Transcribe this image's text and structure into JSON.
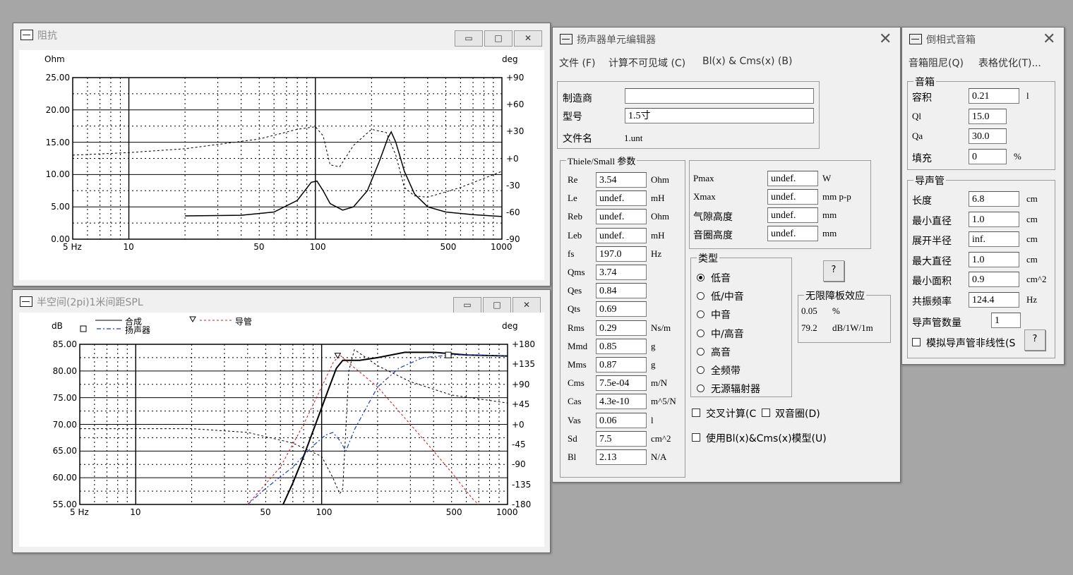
{
  "impedance": {
    "title": "阻抗",
    "y_unit": "Ohm",
    "phase_unit": "deg",
    "y_ticks": [
      "25.00",
      "20.00",
      "15.00",
      "10.00",
      "5.00",
      "0.00"
    ],
    "phase_ticks": [
      "+90",
      "+60",
      "+30",
      "+0",
      "-30",
      "-60",
      "-90"
    ],
    "x_ticks": [
      "5 Hz",
      "10",
      "50",
      "100",
      "500",
      "1000"
    ]
  },
  "spl": {
    "title": "半空间(2pi)1米间距SPL",
    "y_unit": "dB",
    "phase_unit": "deg",
    "legend": {
      "total": "合成",
      "driver": "扬声器",
      "port": "导管"
    },
    "y_ticks": [
      "85.00",
      "80.00",
      "75.00",
      "70.00",
      "65.00",
      "60.00",
      "55.00"
    ],
    "phase_ticks": [
      "+180",
      "+135",
      "+90",
      "+45",
      "+0",
      "-45",
      "-90",
      "-135",
      "-180"
    ],
    "x_ticks": [
      "5 Hz",
      "10",
      "50",
      "100",
      "500",
      "1000"
    ]
  },
  "window_buttons": {
    "min": "▭",
    "max": "□",
    "close": "✕"
  },
  "editor": {
    "title": "扬声器单元编辑器",
    "menu": [
      "文件 (F)",
      "计算不可见域 (C)",
      "Bl(x) & Cms(x) (B)"
    ],
    "maker_label": "制造商",
    "maker_value": "",
    "model_label": "型号",
    "model_value": "1.5寸",
    "file_label": "文件名",
    "file_value": "1.unt",
    "ts_group": "Thiele/Small 参数",
    "params": [
      {
        "name": "Re",
        "value": "3.54",
        "unit": "Ohm"
      },
      {
        "name": "Le",
        "value": "undef.",
        "unit": "mH"
      },
      {
        "name": "Reb",
        "value": "undef.",
        "unit": "Ohm"
      },
      {
        "name": "Leb",
        "value": "undef.",
        "unit": "mH"
      },
      {
        "name": "fs",
        "value": "197.0",
        "unit": "Hz"
      },
      {
        "name": "Qms",
        "value": "3.74",
        "unit": ""
      },
      {
        "name": "Qes",
        "value": "0.84",
        "unit": ""
      },
      {
        "name": "Qts",
        "value": "0.69",
        "unit": ""
      },
      {
        "name": "Rms",
        "value": "0.29",
        "unit": "Ns/m"
      },
      {
        "name": "Mmd",
        "value": "0.85",
        "unit": "g"
      },
      {
        "name": "Mms",
        "value": "0.87",
        "unit": "g"
      },
      {
        "name": "Cms",
        "value": "7.5e-04",
        "unit": "m/N"
      },
      {
        "name": "Cas",
        "value": "4.3e-10",
        "unit": "m^5/N"
      },
      {
        "name": "Vas",
        "value": "0.06",
        "unit": "l"
      },
      {
        "name": "Sd",
        "value": "7.5",
        "unit": "cm^2"
      },
      {
        "name": "Bl",
        "value": "2.13",
        "unit": "N/A"
      }
    ],
    "limits": [
      {
        "name": "Pmax",
        "value": "undef.",
        "unit": "W"
      },
      {
        "name": "Xmax",
        "value": "undef.",
        "unit": "mm p-p"
      },
      {
        "name": "气隙高度",
        "value": "undef.",
        "unit": "mm"
      },
      {
        "name": "音圈高度",
        "value": "undef.",
        "unit": "mm"
      }
    ],
    "type_group": "类型",
    "types": [
      "低音",
      "低/中音",
      "中音",
      "中/高音",
      "高音",
      "全频带",
      "无源辐射器"
    ],
    "type_selected": 0,
    "help": "?",
    "baffle_group": "无限障板效应",
    "baffle_eff": "0.05",
    "baffle_eff_unit": "%",
    "baffle_spl": "79.2",
    "baffle_spl_unit": "dB/1W/1m",
    "cross_calc": "交叉计算(C",
    "dual_coil": "双音圈(D)",
    "blcms_model": "使用Bl(x)&Cms(x)模型(U)"
  },
  "box": {
    "title": "倒相式音箱",
    "menu": [
      "音箱阻尼(Q)",
      "表格优化(T)..."
    ],
    "box_group": "音箱",
    "box_fields": [
      {
        "name": "容积",
        "value": "0.21",
        "unit": "l"
      },
      {
        "name": "Ql",
        "value": "15.0",
        "unit": ""
      },
      {
        "name": "Qa",
        "value": "30.0",
        "unit": ""
      },
      {
        "name": "填充",
        "value": "0",
        "unit": "%"
      }
    ],
    "port_group": "导声管",
    "port_fields": [
      {
        "name": "长度",
        "value": "6.8",
        "unit": "cm"
      },
      {
        "name": "最小直径",
        "value": "1.0",
        "unit": "cm"
      },
      {
        "name": "展开半径",
        "value": "inf.",
        "unit": "cm"
      },
      {
        "name": "最大直径",
        "value": "1.0",
        "unit": "cm"
      },
      {
        "name": "最小面积",
        "value": "0.9",
        "unit": "cm^2"
      },
      {
        "name": "共振频率",
        "value": "124.4",
        "unit": "Hz"
      }
    ],
    "port_count_label": "导声管数量",
    "port_count": "1",
    "nonlinear": "模拟导声管非线性(S",
    "help": "?"
  }
}
